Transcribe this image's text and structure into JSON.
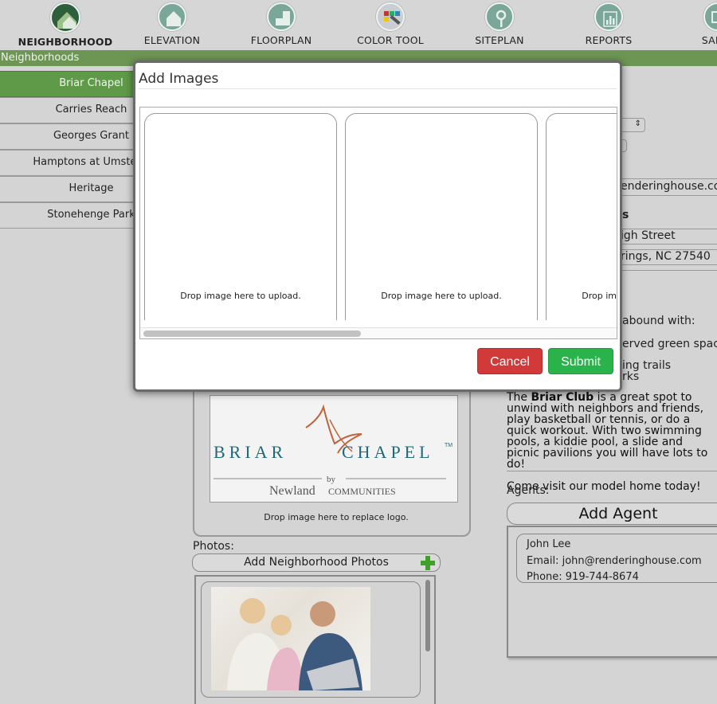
{
  "nav": {
    "items": [
      {
        "label": "NEIGHBORHOOD",
        "icon": "house-icon",
        "active": true
      },
      {
        "label": "ELEVATION",
        "icon": "elevation-house-icon"
      },
      {
        "label": "FLOORPLAN",
        "icon": "floorplan-icon"
      },
      {
        "label": "COLOR TOOL",
        "icon": "color-palette-icon"
      },
      {
        "label": "SITEPLAN",
        "icon": "map-pin-icon"
      },
      {
        "label": "REPORTS",
        "icon": "bar-chart-icon"
      },
      {
        "label": "SALES",
        "icon": "monitor-icon"
      }
    ]
  },
  "breadcrumb": "Neighborhoods",
  "sidebar": {
    "items": [
      {
        "label": "Briar Chapel",
        "active": true
      },
      {
        "label": "Carries Reach"
      },
      {
        "label": "Georges Grant"
      },
      {
        "label": "Hamptons at Umstead"
      },
      {
        "label": "Heritage"
      },
      {
        "label": "Stonehenge Park"
      }
    ]
  },
  "right": {
    "email_partial": "enderinghouse.com",
    "address_heading_partial": "s",
    "street_partial": "igh Street",
    "city_partial": "rings, NC 27540",
    "amenities_partial": "abound with:",
    "amenity_1": "erved green space",
    "amenity_2": "ing trails",
    "amenity_3": "rks"
  },
  "description": {
    "pre": "The ",
    "bold": "Briar Club",
    "post": " is a great spot to unwind with neighbors and friends, play basketball or tennis, or do a quick workout. With two swimming pools, a kiddie pool, a slide and picnic pavilions you will have lots to do!",
    "closing": "Come visit our model home today!"
  },
  "agents": {
    "label": "Agents:",
    "add_label": "Add Agent",
    "list": [
      {
        "name": "John Lee",
        "email": "Email: john@renderinghouse.com",
        "phone": "Phone: 919-744-8674"
      }
    ]
  },
  "logo": {
    "word_left": "BRIAR",
    "word_right": "CHAPEL",
    "tm": "TM",
    "by": "by",
    "newland": "Newland",
    "communities": "COMMUNITIES",
    "caption": "Drop image here to replace logo."
  },
  "photos": {
    "label": "Photos:",
    "add_label": "Add Neighborhood Photos"
  },
  "modal": {
    "title": "Add Images",
    "drop_text": "Drop image here to upload.",
    "slots": 3,
    "cancel_label": "Cancel",
    "submit_label": "Submit"
  },
  "colors": {
    "brand_green": "#6d9655",
    "cancel_red": "#d23a3a",
    "submit_green": "#2bb34b"
  }
}
